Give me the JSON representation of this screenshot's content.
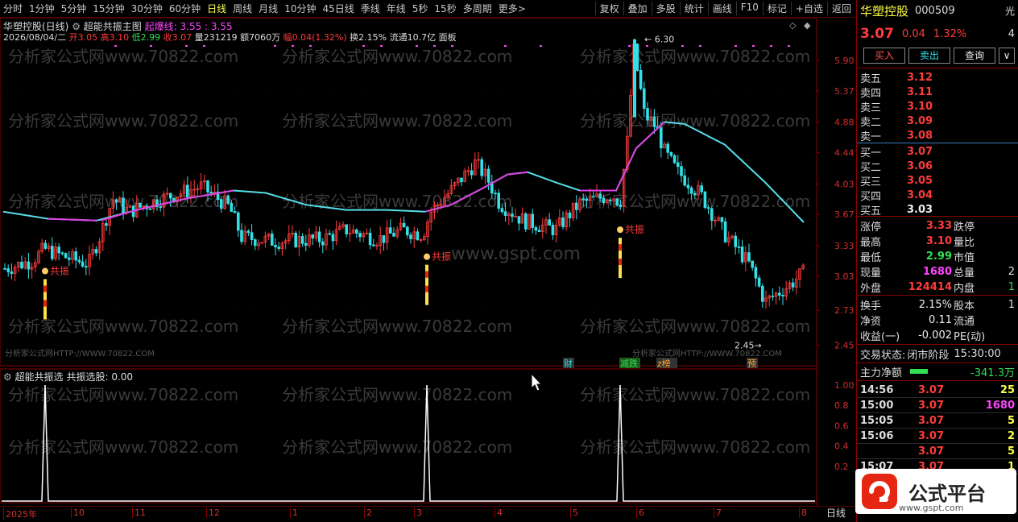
{
  "toolbar": {
    "periods": [
      "分时",
      "1分钟",
      "5分钟",
      "15分钟",
      "30分钟",
      "60分钟",
      "日线",
      "周线",
      "月线",
      "10分钟",
      "45日线",
      "季线",
      "年线",
      "5秒",
      "15秒",
      "多周期",
      "更多>"
    ],
    "active": "日线",
    "actions": [
      "复权",
      "叠加",
      "多股",
      "统计",
      "画线",
      "F10",
      "标记",
      "+自选",
      "返回"
    ]
  },
  "main": {
    "stock_label": "华塑控股(日线)",
    "indicator": "超能共振主图",
    "indicator_extra_label": "起爆线:",
    "indicator_extra_value": "3.55 : 3.55",
    "date": "2026/08/04/二",
    "open_label": "开",
    "open": "3.05",
    "high_label": "高",
    "high": "3.10",
    "low_label": "低",
    "low": "2.99",
    "close_label": "收",
    "close": "3.07",
    "vol_label": "量",
    "vol": "231219",
    "amount_label": "额",
    "amount": "7060万",
    "chg_label": "幅",
    "chg": "0.04(1.32%)",
    "turnover_label": "换",
    "turnover": "2.15%",
    "float_label": "流通",
    "float": "10.7亿",
    "panel_label": "面板"
  },
  "sub": {
    "indicator": "超能共振选",
    "line_label": "共振选股:",
    "line_value": "0.00"
  },
  "price_axis": [
    "5.90",
    "5.37",
    "4.88",
    "4.44",
    "4.03",
    "3.67",
    "3.33",
    "3.03",
    "2.73",
    "2.45"
  ],
  "sub_axis": [
    "1.00",
    "0.8",
    "0.6",
    "0.4",
    "0.2"
  ],
  "annotations": {
    "max_price": "6.30",
    "min_price": "2.45",
    "signal": "共振",
    "tags": [
      "财",
      "减跌",
      "z榜",
      "预"
    ]
  },
  "watermarks": {
    "site": "分析家公式网www.70822.com",
    "url": "分析家公式网HTTP://WWW.70822.COM",
    "gspt": "www.gspt.com"
  },
  "dates": [
    "2025年",
    "10",
    "11",
    "12",
    "1",
    "2",
    "3",
    "4",
    "5",
    "6",
    "7",
    "8"
  ],
  "period_right": "日线",
  "quote": {
    "name": "华塑控股",
    "code": "000509",
    "side_tag": "光",
    "price": "3.07",
    "change": "0.04",
    "change_pct": "1.32%",
    "buttons": [
      "买入",
      "卖出",
      "查询"
    ],
    "asks": [
      {
        "label": "卖五",
        "price": "3.12"
      },
      {
        "label": "卖四",
        "price": "3.11"
      },
      {
        "label": "卖三",
        "price": "3.10"
      },
      {
        "label": "卖二",
        "price": "3.09"
      },
      {
        "label": "卖一",
        "price": "3.08"
      }
    ],
    "bids": [
      {
        "label": "买一",
        "price": "3.07"
      },
      {
        "label": "买二",
        "price": "3.06"
      },
      {
        "label": "买三",
        "price": "3.05"
      },
      {
        "label": "买四",
        "price": "3.04"
      },
      {
        "label": "买五",
        "price": "3.03"
      }
    ],
    "stats": [
      {
        "l1": "涨停",
        "v1": "3.33",
        "l2": "跌停",
        "v2": ""
      },
      {
        "l1": "最高",
        "v1": "3.10",
        "l2": "量比",
        "v2": ""
      },
      {
        "l1": "最低",
        "v1": "2.99",
        "l2": "市值",
        "v2": ""
      },
      {
        "l1": "现量",
        "v1": "1680",
        "l2": "总量",
        "v2": "2"
      },
      {
        "l1": "外盘",
        "v1": "124414",
        "l2": "内盘",
        "v2": "1"
      }
    ],
    "stats2": [
      {
        "l1": "换手",
        "v1": "2.15%",
        "l2": "股本",
        "v2": "1"
      },
      {
        "l1": "净资",
        "v1": "0.11",
        "l2": "流通",
        "v2": ""
      },
      {
        "l1": "收益(一)",
        "v1": "-0.002",
        "l2": "PE(动)",
        "v2": ""
      }
    ],
    "trade_status_label": "交易状态:",
    "trade_status": "闭市阶段",
    "trade_time": "15:30:00",
    "net_flow_label": "主力净额",
    "net_flow": "-341.3万",
    "ticks": [
      {
        "time": "14:56",
        "price": "3.07",
        "vol": "25"
      },
      {
        "time": "15:00",
        "price": "3.07",
        "vol": "1680"
      },
      {
        "time": "15:05",
        "price": "3.07",
        "vol": "5"
      },
      {
        "time": "15:06",
        "price": "3.07",
        "vol": "2"
      },
      {
        "time": "",
        "price": "3.07",
        "vol": "5"
      },
      {
        "time": "15:07",
        "price": "3.07",
        "vol": "1"
      }
    ]
  },
  "brand": {
    "name": "公式平台",
    "url": "www.gspt.com"
  }
}
